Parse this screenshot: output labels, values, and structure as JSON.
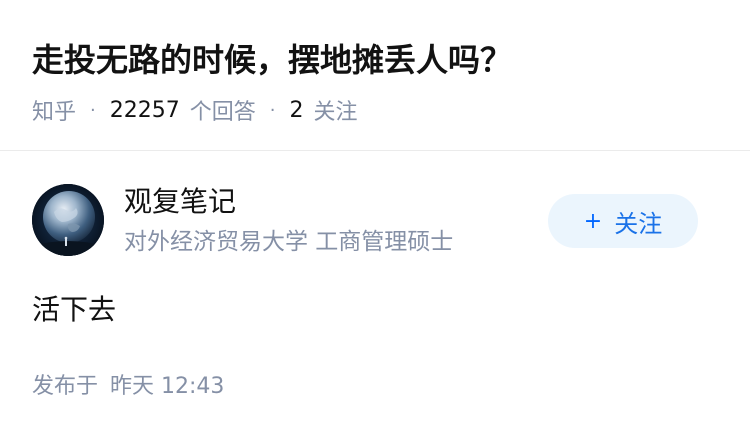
{
  "question": {
    "title": "走投无路的时候，摆地摊丢人吗？",
    "source": "知乎",
    "answer_count": "22257",
    "answer_label": "个回答",
    "follow_count": "2",
    "follow_label": "关注"
  },
  "answer": {
    "author": {
      "name": "观复笔记",
      "bio": "对外经济贸易大学 工商管理硕士",
      "avatar_icon": "earth-avatar-icon"
    },
    "follow_button": {
      "icon": "+",
      "label": "关注"
    },
    "content": "活下去",
    "published_label": "发布于",
    "published_time": "昨天 12:43"
  },
  "colors": {
    "text_primary": "#121212",
    "text_secondary": "#8590a6",
    "accent": "#0066ff",
    "button_bg": "#ebf5fd",
    "divider": "#ebebeb"
  }
}
